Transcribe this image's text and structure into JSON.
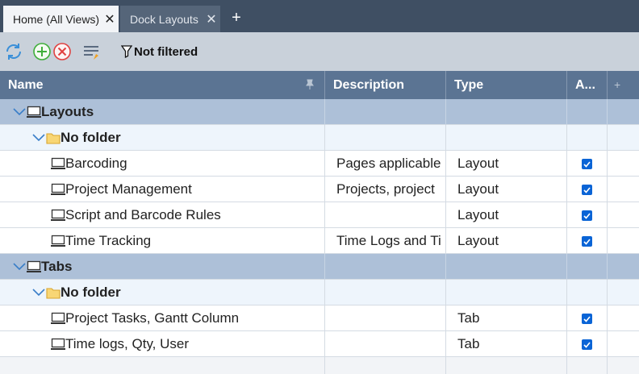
{
  "tabs": [
    {
      "label": "Home (All Views)",
      "active": true,
      "close": "✕"
    },
    {
      "label": "Dock Layouts",
      "active": false,
      "close": "✕"
    }
  ],
  "add_tab": "+",
  "toolbar": {
    "buttons": [
      "refresh-icon",
      "add-icon",
      "delete-icon",
      "edit-list-icon"
    ],
    "filter_label": "Not filtered"
  },
  "columns": {
    "name": "Name",
    "description": "Description",
    "type": "Type",
    "active": "A...",
    "add": "+"
  },
  "groups": [
    {
      "label": "Layouts",
      "folder": "No folder",
      "items": [
        {
          "name": "Barcoding",
          "description": "Pages applicable",
          "type": "Layout",
          "active": true
        },
        {
          "name": "Project Management",
          "description": "Projects, project",
          "type": "Layout",
          "active": true
        },
        {
          "name": "Script and Barcode Rules",
          "description": "",
          "type": "Layout",
          "active": true
        },
        {
          "name": "Time Tracking",
          "description": "Time Logs and Ti",
          "type": "Layout",
          "active": true
        }
      ]
    },
    {
      "label": "Tabs",
      "folder": "No folder",
      "items": [
        {
          "name": "Project Tasks, Gantt Column",
          "description": "",
          "type": "Tab",
          "active": true
        },
        {
          "name": "Time logs, Qty, User",
          "description": "",
          "type": "Tab",
          "active": true
        }
      ]
    }
  ],
  "colors": {
    "tabbar": "#3f4f63",
    "header": "#5b7493",
    "group_row": "#adc0d8",
    "checkbox": "#0a64d6"
  }
}
